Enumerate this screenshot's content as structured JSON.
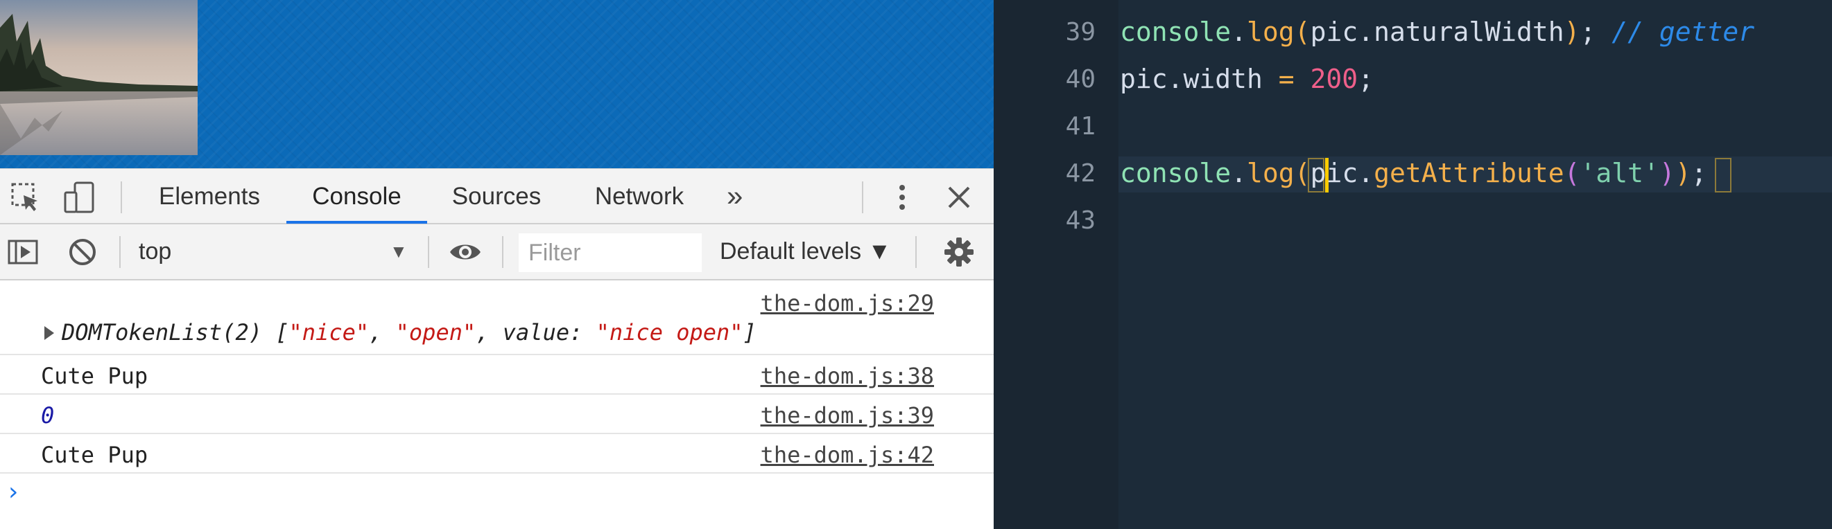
{
  "devtools": {
    "tabs": [
      {
        "label": "Elements"
      },
      {
        "label": "Console",
        "active": true
      },
      {
        "label": "Sources"
      },
      {
        "label": "Network"
      }
    ],
    "more_tabs": "»",
    "context": "top",
    "filter_placeholder": "Filter",
    "levels": "Default levels ▼"
  },
  "console": {
    "messages": [
      {
        "source": "the-dom.js:29",
        "text": {
          "prefix": "DOMTokenList(2) [",
          "s1": "\"nice\"",
          "sep1": ", ",
          "s2": "\"open\"",
          "sep2": ", value: ",
          "s3": "\"nice open\"",
          "suffix": "]"
        }
      },
      {
        "source": "the-dom.js:38",
        "text": "Cute Pup"
      },
      {
        "source": "the-dom.js:39",
        "text": "0"
      },
      {
        "source": "the-dom.js:42",
        "text": "Cute Pup"
      }
    ],
    "prompt": "›"
  },
  "editor": {
    "lines": [
      {
        "number": "39",
        "tokens": [
          "console",
          ".",
          "log",
          "(",
          "pic.naturalWidth",
          ")",
          "; ",
          "// getter"
        ]
      },
      {
        "number": "40",
        "tokens": [
          "pic.width",
          " = ",
          "200",
          ";"
        ]
      },
      {
        "number": "41",
        "tokens": []
      },
      {
        "number": "42",
        "tokens": [
          "console",
          ".",
          "log",
          "(",
          "pic.",
          "getAttribute",
          "(",
          "'alt'",
          ")",
          ")",
          ";"
        ]
      },
      {
        "number": "43",
        "tokens": []
      }
    ]
  },
  "colors": {
    "page_bg": "#0b6ab8",
    "editor_bg": "#1c2b39",
    "accent": "#1a73e8"
  }
}
